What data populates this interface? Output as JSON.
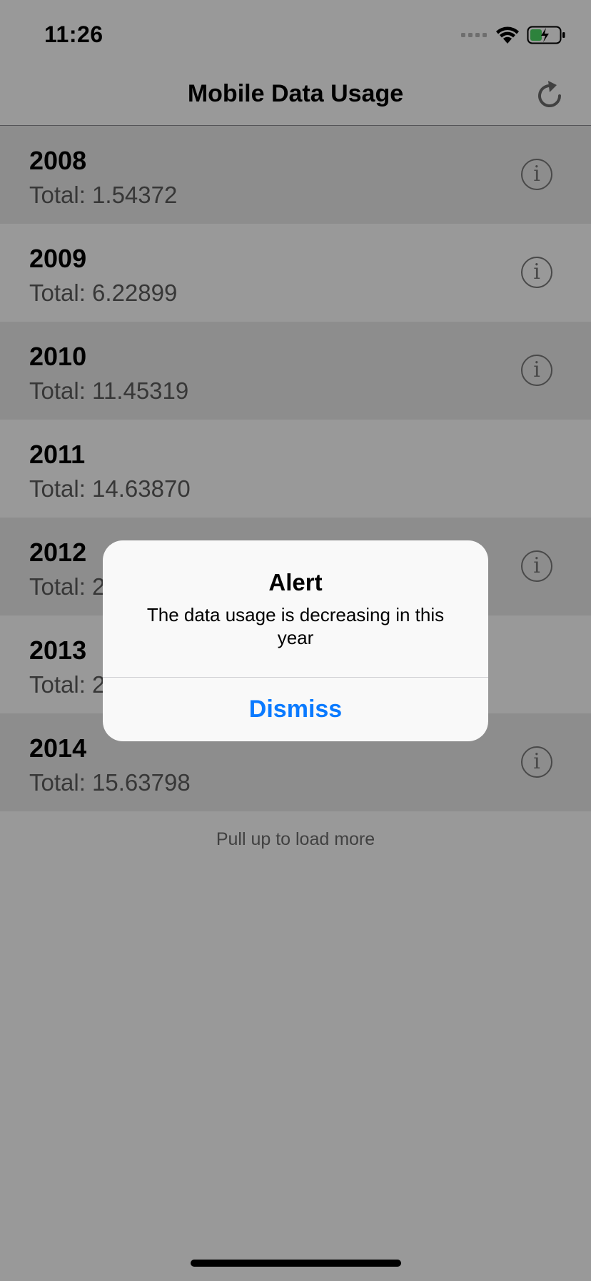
{
  "status_bar": {
    "time": "11:26"
  },
  "nav": {
    "title": "Mobile Data Usage"
  },
  "rows": [
    {
      "year": "2008",
      "total": "Total: 1.54372",
      "has_info": true
    },
    {
      "year": "2009",
      "total": "Total: 6.22899",
      "has_info": true
    },
    {
      "year": "2010",
      "total": "Total: 11.45319",
      "has_info": true
    },
    {
      "year": "2011",
      "total": "Total: 14.63870",
      "has_info": false
    },
    {
      "year": "2012",
      "total": "Total: 2",
      "has_info": true
    },
    {
      "year": "2013",
      "total": "Total: 2",
      "has_info": false
    },
    {
      "year": "2014",
      "total": "Total: 15.63798",
      "has_info": true
    }
  ],
  "footer": {
    "pull_text": "Pull up to load more"
  },
  "alert": {
    "title": "Alert",
    "message": "The data usage is decreasing in this year",
    "button": "Dismiss"
  },
  "colors": {
    "accent": "#0a7aff",
    "battery": "#4cd964",
    "row_alt": "#ececec"
  }
}
